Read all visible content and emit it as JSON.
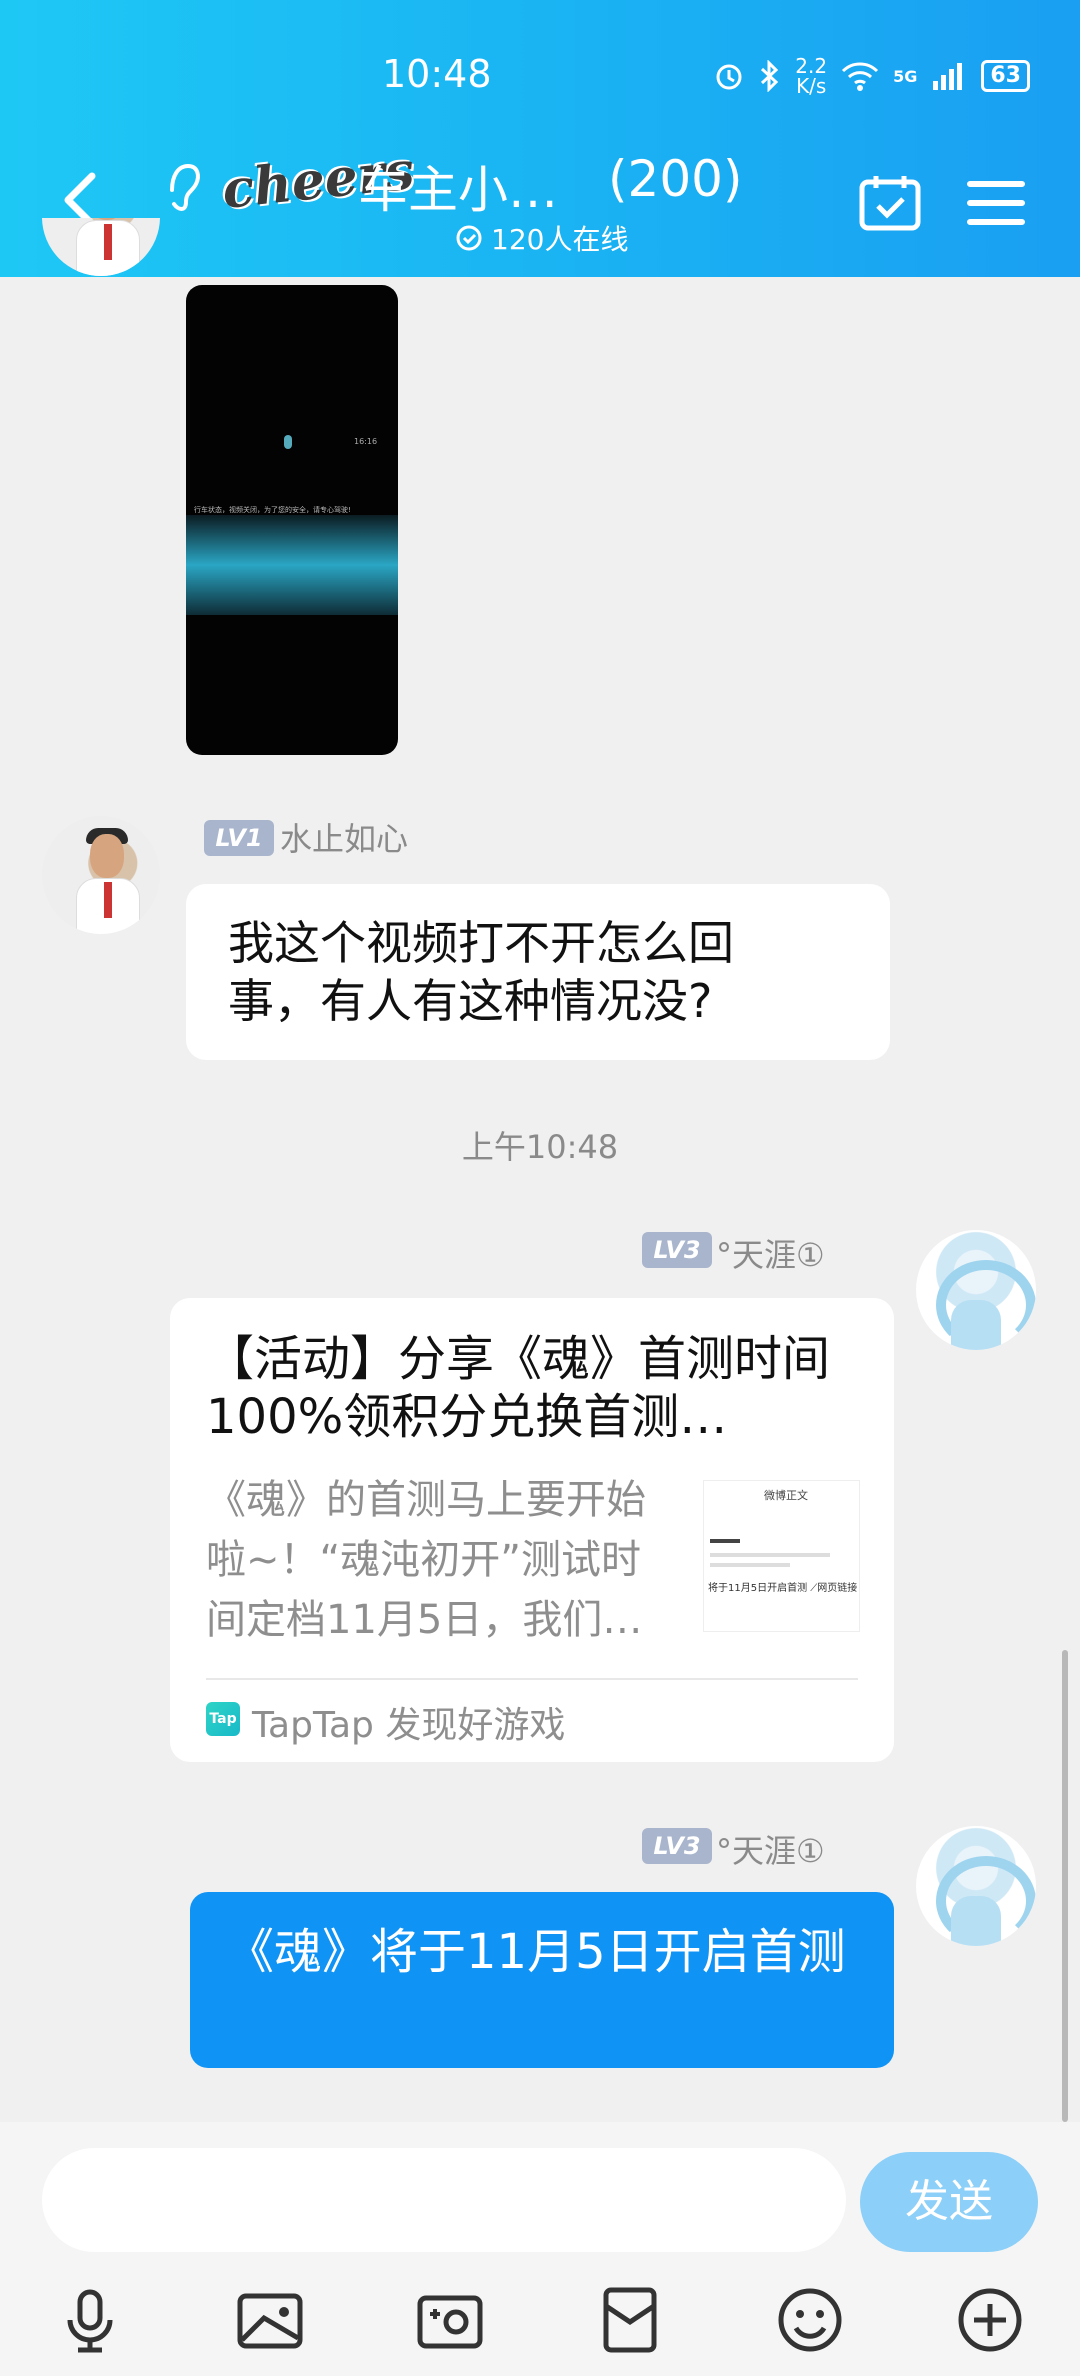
{
  "status_bar": {
    "time": "10:48",
    "net_speed_value": "2.2",
    "net_speed_unit": "K/s",
    "network": "5G",
    "battery": "63"
  },
  "header": {
    "title": "车主小…",
    "logo_text": "cheers",
    "member_count": "(200)",
    "online": "120人在线"
  },
  "messages": [
    {
      "type": "video",
      "sender_level": "",
      "sender_name": "",
      "video_caption": "行车状态，视频关闭，为了您的安全，请专心驾驶!",
      "video_clock": "16:16"
    },
    {
      "type": "text",
      "sender_level": "LV1",
      "sender_name": "水止如心",
      "text": "我这个视频打不开怎么回事，有人有这种情况没?"
    },
    {
      "type": "timestamp",
      "text": "上午10:48"
    },
    {
      "type": "card",
      "sender_level": "LV3",
      "sender_name": "°天涯①",
      "title": "【活动】分享《魂》首测时间 100%领积分兑换首测…",
      "desc": "《魂》的首测马上要开始啦~！“魂沌初开”测试时间定档11月5日，我们…",
      "thumb_title": "微博正文",
      "thumb_text": "将于11月5日开启首测 ⟋网页链接",
      "source": "TapTap 发现好游戏",
      "source_icon_text": "Tap"
    },
    {
      "type": "text_self",
      "sender_level": "LV3",
      "sender_name": "°天涯①",
      "text": "《魂》将于11月5日开启首测"
    }
  ],
  "composer": {
    "placeholder": "",
    "send_label": "发送"
  },
  "toolbar": [
    "microphone-icon",
    "image-icon",
    "camera-icon",
    "red-packet-icon",
    "emoji-icon",
    "plus-icon"
  ],
  "colors": {
    "header_start": "#1ec8f5",
    "header_end": "#1a9ff2",
    "bubble_self": "#0f93f5",
    "send_button": "#8ccff8"
  }
}
